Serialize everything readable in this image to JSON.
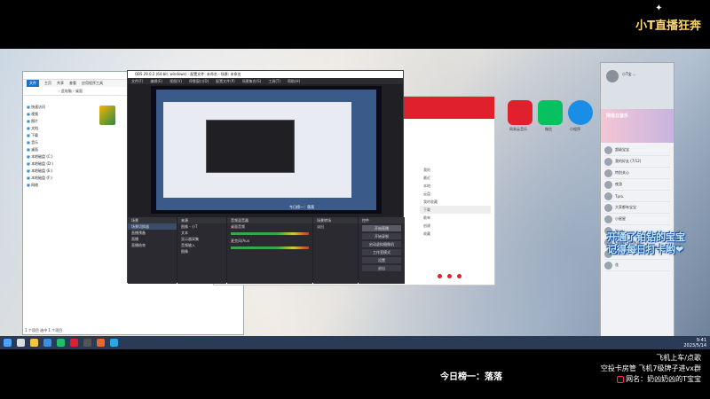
{
  "stream": {
    "logo": "小T直播狂奔",
    "caption_line1": "开通了铂钻的宝宝",
    "caption_line2": "记得每日打卡哟❤",
    "rank_text": "今日榜一：落落",
    "info_line1": "飞机上车/点歌",
    "info_line2": "空投卡房管 飞机7级牌子进vx群",
    "info_line3": "网名：奶凶奶凶的T宝宝"
  },
  "explorer": {
    "title": "",
    "ribbon": [
      "文件",
      "主页",
      "共享",
      "查看",
      "应用程序工具"
    ],
    "address": "› 此电脑 › 桌面",
    "side_items": [
      "快速访问",
      "视频",
      "图片",
      "文档",
      "下载",
      "音乐",
      "桌面",
      "本地磁盘 (C:)",
      "本地磁盘 (D:)",
      "本地磁盘 (E:)",
      "本地磁盘 (F:)",
      "网络"
    ],
    "status": "1 个项目   选中 1 个项目"
  },
  "obs": {
    "title": "OBS 29.0.2 (64-bit, windows) - 配置文件: 未命名 - 场景: 未命名",
    "menu": [
      "文件(F)",
      "编辑(E)",
      "视图(V)",
      "停靠窗口(D)",
      "配置文件(P)",
      "场景集合(S)",
      "工具(T)",
      "帮助(H)"
    ],
    "preview_caption": "今日榜一：落落",
    "docks": {
      "scenes_header": "场景",
      "scenes": [
        "场景切换器",
        "直播预备",
        "直播",
        "直播结束"
      ],
      "sources_header": "来源",
      "sources": [
        "图像 - 小T",
        "文本",
        "显示器采集",
        "音频输入",
        "图像"
      ],
      "mixer_header": "音频混音器",
      "mixer": [
        "桌面音频",
        "麦克风/Aux"
      ],
      "transitions_header": "场景转场",
      "transition_value": "淡出",
      "controls_header": "控件",
      "controls": [
        "开始直播",
        "开始录制",
        "启动虚拟摄像机",
        "工作室模式",
        "设置",
        "退出"
      ]
    }
  },
  "music": {
    "menu": [
      "我的",
      "最近",
      "本地",
      "云盘",
      "我的收藏",
      "下载",
      "歌单",
      "创建",
      "收藏"
    ],
    "highlight_index": 5
  },
  "apps": [
    {
      "label": "网易云音乐",
      "color": "#e0212d"
    },
    {
      "label": "微信",
      "color": "#07c160"
    },
    {
      "label": "小程序",
      "color": "#1a8ee6"
    }
  ],
  "qq": {
    "name": "小T宝 ...",
    "banner": "网易云音乐",
    "items": [
      "超级宝宝",
      "我的好友 (7/12)",
      "特别关心",
      "夜游",
      "Tpro.",
      "大家都有宝宝",
      "小星星",
      "Yoyo",
      "Deep CHANGE",
      "我的奶凶",
      "花"
    ]
  },
  "taskbar": {
    "time": "9:41",
    "date": "2023/5/14"
  }
}
